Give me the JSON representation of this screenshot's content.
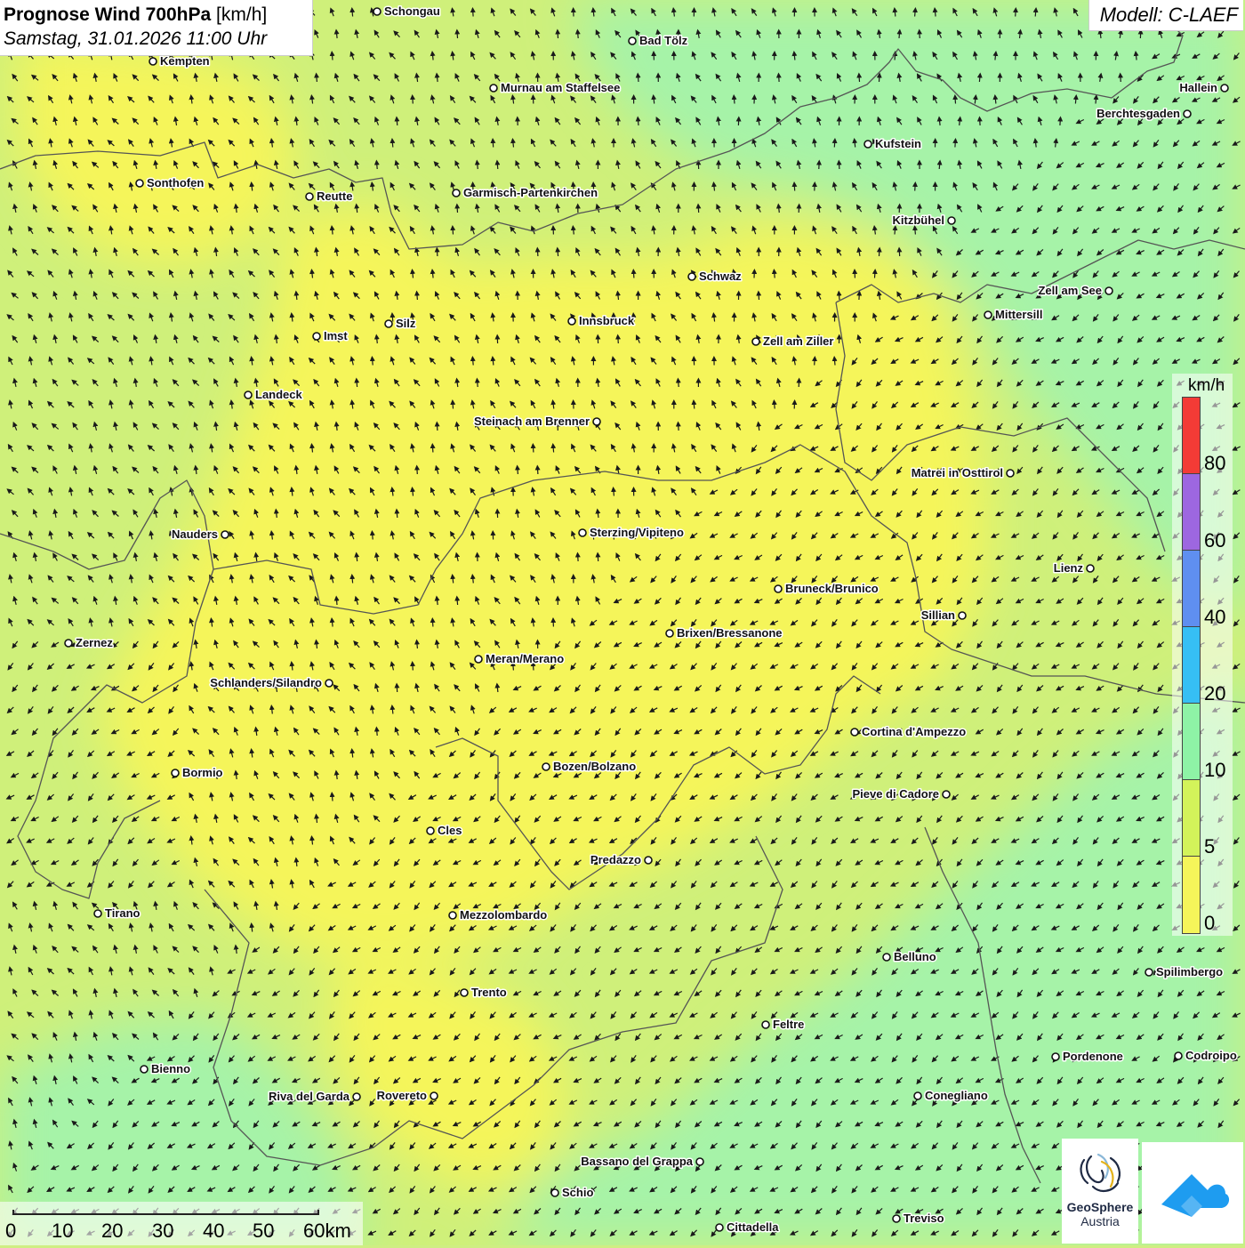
{
  "header": {
    "title_bold": "Prognose Wind 700hPa",
    "title_unit": "[km/h]",
    "datetime": "Samstag, 31.01.2026 11:00 Uhr"
  },
  "model_label": "Modell: C-LAEF",
  "legend": {
    "unit": "km/h",
    "ticks": [
      "80",
      "60",
      "40",
      "20",
      "10",
      "5",
      "0"
    ],
    "colors_top_to_bottom": [
      "#f33b36",
      "#9d67e0",
      "#5f8ff0",
      "#36bff4",
      "#8ef3a6",
      "#d3f35a",
      "#f5f55a"
    ]
  },
  "scalebar": {
    "labels": [
      "0",
      "10",
      "20",
      "30",
      "40",
      "50",
      "60km"
    ]
  },
  "logos": {
    "geosphere_name": "GeoSphere",
    "geosphere_sub": "Austria"
  },
  "map_colors": {
    "calm_yellow": "#f5f55a",
    "light_green": "#cff07a",
    "mint": "#a6f3a8",
    "arrow": "#1a1a1a",
    "border": "#555555"
  },
  "cities": [
    {
      "name": "Schongau"
    },
    {
      "name": "Bad Tölz"
    },
    {
      "name": "Kempten"
    },
    {
      "name": "Murnau am Staffelsee"
    },
    {
      "name": "Hallein"
    },
    {
      "name": "Berchtesgaden"
    },
    {
      "name": "Kufstein"
    },
    {
      "name": "Sonthofen"
    },
    {
      "name": "Reutte"
    },
    {
      "name": "Garmisch-Partenkirchen"
    },
    {
      "name": "Kitzbühel"
    },
    {
      "name": "Schwaz"
    },
    {
      "name": "Zell am See"
    },
    {
      "name": "Mittersill"
    },
    {
      "name": "Innsbruck"
    },
    {
      "name": "Silz"
    },
    {
      "name": "Imst"
    },
    {
      "name": "Zell am Ziller"
    },
    {
      "name": "Landeck"
    },
    {
      "name": "Steinach am Brenner"
    },
    {
      "name": "Matrei in Osttirol"
    },
    {
      "name": "Nauders"
    },
    {
      "name": "Sterzing/Vipiteno"
    },
    {
      "name": "Lienz"
    },
    {
      "name": "Bruneck/Brunico"
    },
    {
      "name": "Sillian"
    },
    {
      "name": "Zernez"
    },
    {
      "name": "Brixen/Bressanone"
    },
    {
      "name": "Meran/Merano"
    },
    {
      "name": "Schlanders/Silandro"
    },
    {
      "name": "Cortina d'Ampezzo"
    },
    {
      "name": "Bozen/Bolzano"
    },
    {
      "name": "Bormio"
    },
    {
      "name": "Pieve di Cadore"
    },
    {
      "name": "Cles"
    },
    {
      "name": "Predazzo"
    },
    {
      "name": "Tirano"
    },
    {
      "name": "Mezzolombardo"
    },
    {
      "name": "Belluno"
    },
    {
      "name": "Spilimbergo"
    },
    {
      "name": "Trento"
    },
    {
      "name": "Feltre"
    },
    {
      "name": "Pordenone"
    },
    {
      "name": "Codroipo"
    },
    {
      "name": "Bienno"
    },
    {
      "name": "Riva del Garda"
    },
    {
      "name": "Rovereto"
    },
    {
      "name": "Conegliano"
    },
    {
      "name": "Bassano del Grappa"
    },
    {
      "name": "Schio"
    },
    {
      "name": "Treviso"
    },
    {
      "name": "Cittadella"
    }
  ]
}
